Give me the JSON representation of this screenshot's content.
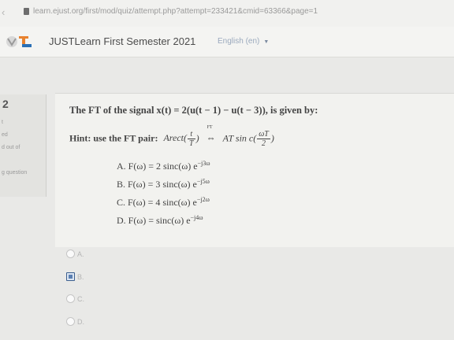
{
  "browser": {
    "url": "learn.ejust.org/first/mod/quiz/attempt.php?attempt=233421&cmid=63366&page=1"
  },
  "header": {
    "site_name": "JUSTLearn First Semester 2021",
    "language": "English (en)"
  },
  "sidebar": {
    "question_number": "2",
    "lines": [
      "t",
      "ed",
      "d out of",
      "g question"
    ]
  },
  "question": {
    "title": "The FT of the signal x(t) = 2(u(t − 1) − u(t − 3)), is given by:",
    "hint_label": "Hint: use the FT pair:",
    "hint_left": "Arect(",
    "hint_left_num": "t",
    "hint_left_den": "T",
    "hint_left_close": ")",
    "hint_arrow_label": "FT",
    "hint_arrow": "⇔",
    "hint_right": "AT sin c(",
    "hint_right_num": "ωT",
    "hint_right_den": "2",
    "hint_right_close": ")",
    "choices": [
      {
        "prefix": "A.  F(ω) = 2 sinc(ω) e",
        "exp": "−j3ω"
      },
      {
        "prefix": "B.  F(ω) = 3 sinc(ω) e",
        "exp": "−j5ω"
      },
      {
        "prefix": "C.  F(ω) = 4 sinc(ω) e",
        "exp": "−j2ω"
      },
      {
        "prefix": "D.  F(ω) =  sinc(ω) e",
        "exp": "−j4ω"
      }
    ]
  },
  "answers": [
    {
      "label": "A.",
      "selected": false
    },
    {
      "label": "B.",
      "selected": true
    },
    {
      "label": "C.",
      "selected": false
    },
    {
      "label": "D.",
      "selected": false
    }
  ],
  "colors": {
    "selected_radio": "#5b7fb2",
    "logo_orange": "#e8822f",
    "logo_blue": "#2a6fb5"
  }
}
